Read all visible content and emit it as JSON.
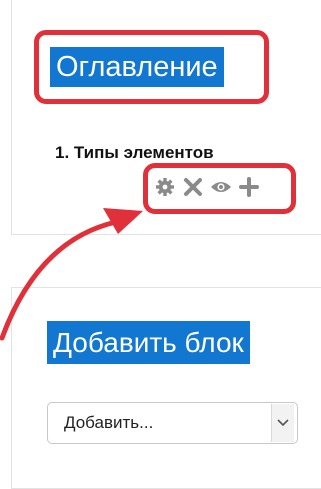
{
  "toc_block": {
    "title": "Оглавление",
    "item": "1. Типы элементов",
    "actions": [
      "gear-icon",
      "close-icon",
      "eye-icon",
      "plus-icon"
    ]
  },
  "add_block": {
    "title": "Добавить блок",
    "select": {
      "selected": "Добавить..."
    }
  },
  "colors": {
    "accent": "#1177d1",
    "highlight": "#e0303a",
    "icon": "#8a8a8a"
  }
}
